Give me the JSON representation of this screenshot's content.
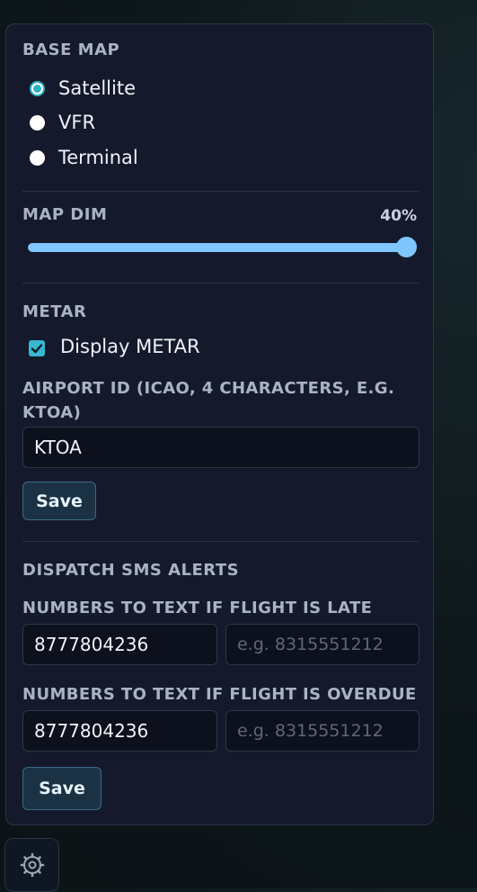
{
  "base_map": {
    "title": "BASE MAP",
    "options": [
      {
        "label": "Satellite",
        "selected": true
      },
      {
        "label": "VFR",
        "selected": false
      },
      {
        "label": "Terminal",
        "selected": false
      }
    ]
  },
  "map_dim": {
    "title": "MAP DIM",
    "value_text": "40%",
    "slider_fraction": 1.0
  },
  "metar": {
    "title": "METAR",
    "display_label": "Display METAR",
    "display_checked": true,
    "airport_label": "AIRPORT ID (ICAO, 4 CHARACTERS, E.G. KTOA)",
    "airport_value": "KTOA",
    "save_label": "Save"
  },
  "sms": {
    "title": "DISPATCH SMS ALERTS",
    "late_label": "NUMBERS TO TEXT IF FLIGHT IS LATE",
    "late_value": "8777804236",
    "late_placeholder": "e.g. 8315551212",
    "overdue_label": "NUMBERS TO TEXT IF FLIGHT IS OVERDUE",
    "overdue_value": "8777804236",
    "overdue_placeholder": "e.g. 8315551212",
    "save_label": "Save"
  },
  "colors": {
    "accent": "#2fb1c6",
    "slider": "#7fc6ff",
    "panel_bg": "#141a2c"
  },
  "icons": {
    "settings": "gear-icon"
  }
}
